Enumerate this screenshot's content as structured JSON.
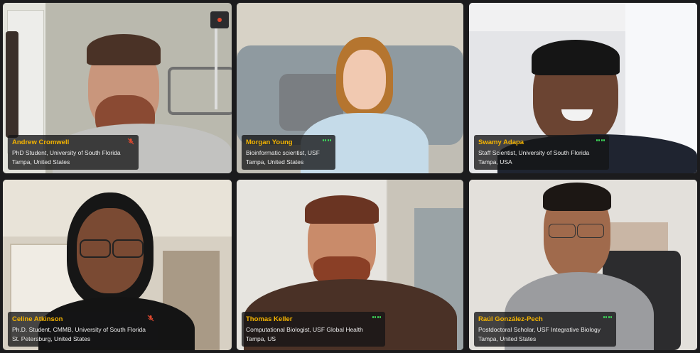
{
  "participants": [
    {
      "name": "Andrew Cromwell",
      "title": "PhD Student, University of South Florida",
      "location": "Tampa, United States",
      "audio": "muted",
      "mic_icon": "mic-muted-icon",
      "bg": "#b9b8ae",
      "accent": "#8c6d5a"
    },
    {
      "name": "Morgan Young",
      "title": "Bioinformatic scientist, USF",
      "location": "Tampa, United States",
      "audio": "active",
      "mic_icon": "audio-level-icon",
      "bg": "#a8a7a2",
      "accent": "#c7dbe8"
    },
    {
      "name": "Swamy Adapa",
      "title": "Staff Scientist, University of South Florida",
      "location": "Tampa, USA",
      "audio": "active",
      "mic_icon": "audio-level-icon",
      "bg": "#e6e7ea",
      "accent": "#1f2430"
    },
    {
      "name": "Celine Atkinson",
      "title": "Ph.D. Student, CMMB, University of South Florida",
      "location": "St. Petersburg, United States",
      "audio": "muted",
      "mic_icon": "mic-muted-icon",
      "bg": "#cfc8bb",
      "accent": "#151515"
    },
    {
      "name": "Thomas Keller",
      "title": "Computational Biologist, USF Global Health",
      "location": "Tampa, US",
      "audio": "active",
      "mic_icon": "audio-level-icon",
      "bg": "#dddad4",
      "accent": "#5a3c2b"
    },
    {
      "name": "Raúl González-Pech",
      "title": "Postdoctoral Scholar, USF Integrative Biology",
      "location": "Tampa, United States",
      "audio": "active",
      "mic_icon": "audio-level-icon",
      "bg": "#d9d6d1",
      "accent": "#9a9b9e"
    }
  ],
  "colors": {
    "name_highlight": "#f5b400",
    "audio_active": "#3ddc5a",
    "audio_muted": "#e2492f",
    "background": "#1b1b1d"
  }
}
